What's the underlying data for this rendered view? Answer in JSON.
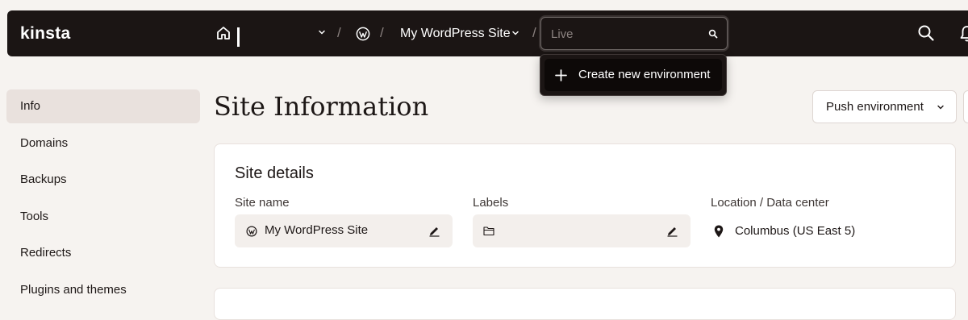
{
  "topbar": {
    "logo": "kinsta",
    "crumb_separator": "/",
    "site_name": "My WordPress Site",
    "environment_placeholder": "Live",
    "icons": [
      "home-icon",
      "chevron-down-icon",
      "wordpress-icon",
      "search-icon",
      "bell-icon"
    ]
  },
  "dropdown": {
    "create_label": "Create new environment",
    "icon": "plus-icon"
  },
  "sidebar": {
    "items": [
      {
        "label": "Info",
        "active": true
      },
      {
        "label": "Domains",
        "active": false
      },
      {
        "label": "Backups",
        "active": false
      },
      {
        "label": "Tools",
        "active": false
      },
      {
        "label": "Redirects",
        "active": false
      },
      {
        "label": "Plugins and themes",
        "active": false
      }
    ]
  },
  "main": {
    "title": "Site Information",
    "push_button": "Push environment",
    "card": {
      "title": "Site details",
      "site_name_label": "Site name",
      "site_name_value": "My WordPress Site",
      "labels_label": "Labels",
      "location_label": "Location / Data center",
      "location_value": "Columbus (US East 5)"
    }
  },
  "colors": {
    "topbar_bg": "#1b1514",
    "page_bg": "#f6f3f0",
    "active_item_bg": "#e9e1dd"
  }
}
